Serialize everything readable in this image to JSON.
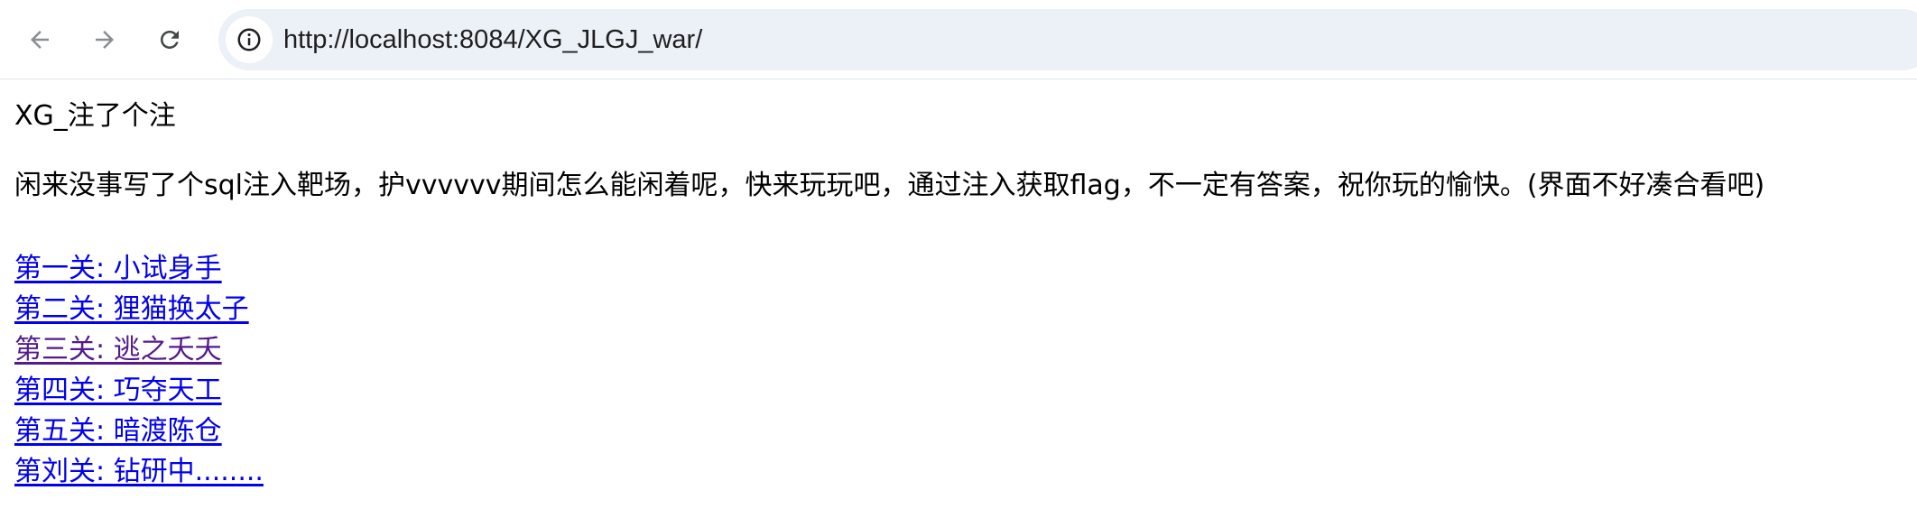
{
  "browser": {
    "url": "http://localhost:8084/XG_JLGJ_war/",
    "icons": {
      "back": "arrow-left-icon",
      "forward": "arrow-right-icon",
      "reload": "reload-icon",
      "site_info": "info-icon"
    }
  },
  "page": {
    "title": "XG_注了个注",
    "intro": "闲来没事写了个sql注入靶场，护vvvvvv期间怎么能闲着呢，快来玩玩吧，通过注入获取flag，不一定有答案，祝你玩的愉快。(界面不好凑合看吧)",
    "levels": [
      {
        "label": "第一关: 小试身手",
        "visited": false
      },
      {
        "label": "第二关: 狸猫换太子",
        "visited": false
      },
      {
        "label": "第三关: 逃之夭夭",
        "visited": true
      },
      {
        "label": "第四关: 巧夺天工",
        "visited": false
      },
      {
        "label": "第五关: 暗渡陈仓",
        "visited": false
      },
      {
        "label": "第刘关: 钻研中........",
        "visited": false
      }
    ]
  },
  "colors": {
    "link": "#0000ee",
    "link_visited": "#551a8b",
    "omnibox_bg": "#ecf0f7",
    "icon": "#5f6368"
  }
}
